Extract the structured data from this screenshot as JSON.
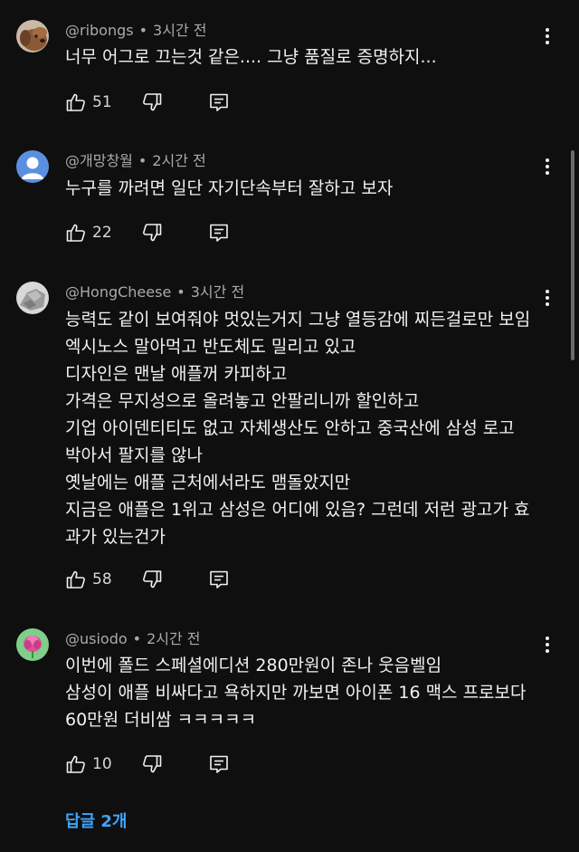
{
  "time_sep": "•",
  "comments": [
    {
      "username": "@ribongs",
      "time": "3시간 전",
      "avatar_icon": "dog-photo-avatar",
      "lines": [
        "너무 어그로 끄는것 같은.... 그냥 품질로 증명하지..."
      ],
      "likes": "51"
    },
    {
      "username": "@개망창월",
      "time": "2시간 전",
      "avatar_icon": "default-person-avatar",
      "lines": [
        "누구를 까려면 일단 자기단속부터 잘하고 보자"
      ],
      "likes": "22"
    },
    {
      "username": "@HongCheese",
      "time": "3시간 전",
      "avatar_icon": "gray-photo-avatar",
      "lines": [
        "능력도 같이 보여줘야 멋있는거지 그냥 열등감에 찌든걸로만 보임",
        "엑시노스 말아먹고 반도체도 밀리고 있고",
        "디자인은 맨날 애플꺼 카피하고",
        "가격은 무지성으로 올려놓고 안팔리니까 할인하고",
        "기업 아이덴티티도 없고 자체생산도 안하고 중국산에 삼성 로고",
        "박아서 팔지를 않나",
        "옛날에는 애플 근처에서라도 맴돌았지만",
        "지금은 애플은 1위고 삼성은 어디에 있음? 그런데 저런 광고가 효",
        "과가 있는건가"
      ],
      "likes": "58"
    },
    {
      "username": "@usiodo",
      "time": "2시간 전",
      "avatar_icon": "pink-flower-avatar",
      "lines": [
        "이번에 폴드 스페셜에디션 280만원이 존나 웃음벨임",
        "삼성이 애플 비싸다고 욕하지만 까보면 아이폰 16 맥스 프로보다",
        "60만원 더비쌈 ㅋㅋㅋㅋㅋ"
      ],
      "likes": "10"
    }
  ],
  "replies_link": "답글 2개",
  "colors": {
    "background": "#0f0f0f",
    "text": "#f1f1f1",
    "secondary": "#aaaaaa",
    "link": "#3ea6ff"
  }
}
